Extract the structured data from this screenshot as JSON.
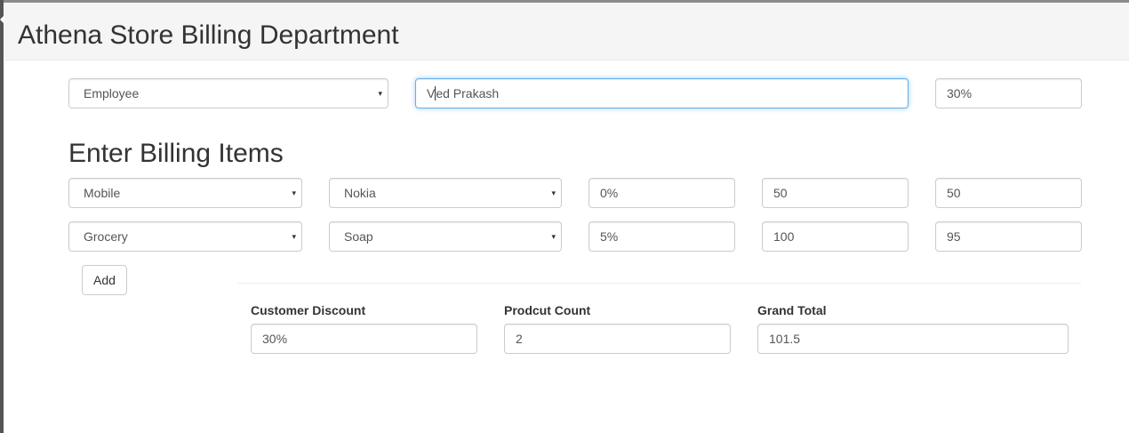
{
  "header": {
    "title": "Athena Store Billing Department"
  },
  "customer": {
    "type_selected": "Employee",
    "name_before_caret": "V",
    "name_after_caret": "ed Prakash",
    "discount": "30%"
  },
  "billing": {
    "section_title": "Enter Billing Items",
    "items": [
      {
        "category": "Mobile",
        "product": "Nokia",
        "discount": "0%",
        "price": "50",
        "total": "50"
      },
      {
        "category": "Grocery",
        "product": "Soap",
        "discount": "5%",
        "price": "100",
        "total": "95"
      }
    ],
    "add_label": "Add"
  },
  "summary": {
    "customer_discount_label": "Customer Discount",
    "customer_discount_value": "30%",
    "product_count_label": "Prodcut Count",
    "product_count_value": "2",
    "grand_total_label": "Grand Total",
    "grand_total_value": "101.5"
  },
  "icons": {
    "dropdown": "▾"
  }
}
